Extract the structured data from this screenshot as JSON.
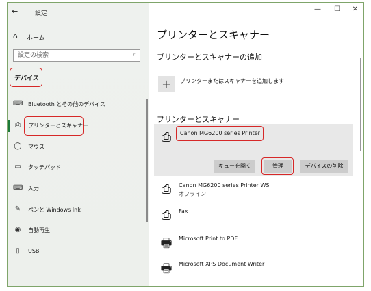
{
  "window": {
    "back_label": "←",
    "title": "設定",
    "minimize_label": "—",
    "maximize_label": "☐",
    "close_label": "✕"
  },
  "sidebar": {
    "home_label": "ホーム",
    "search_placeholder": "設定の検索",
    "category": "デバイス",
    "items": [
      {
        "label": "Bluetooth とその他のデバイス",
        "icon": "bluetooth-devices-icon",
        "glyph": "⌨"
      },
      {
        "label": "プリンターとスキャナー",
        "icon": "printer-icon",
        "glyph": "⎙",
        "active": true
      },
      {
        "label": "マウス",
        "icon": "mouse-icon",
        "glyph": "◯"
      },
      {
        "label": "タッチパッド",
        "icon": "touchpad-icon",
        "glyph": "▭"
      },
      {
        "label": "入力",
        "icon": "keyboard-icon",
        "glyph": "⌨"
      },
      {
        "label": "ペンと Windows Ink",
        "icon": "pen-icon",
        "glyph": "✎"
      },
      {
        "label": "自動再生",
        "icon": "autoplay-icon",
        "glyph": "◉"
      },
      {
        "label": "USB",
        "icon": "usb-icon",
        "glyph": "▯"
      }
    ]
  },
  "main": {
    "title": "プリンターとスキャナー",
    "add_section_title": "プリンターとスキャナーの追加",
    "add_button_symbol": "+",
    "add_button_label": "プリンターまたはスキャナーを追加します",
    "list_section_title": "プリンターとスキャナー",
    "selected_printer": {
      "name": "Canon MG6200 series Printer",
      "buttons": {
        "open_queue": "キューを開く",
        "manage": "管理",
        "remove": "デバイスの削除"
      }
    },
    "printers": [
      {
        "name": "Canon MG6200 series Printer WS",
        "status": "オフライン",
        "icon": "printer-icon"
      },
      {
        "name": "Fax",
        "status": "",
        "icon": "fax-icon"
      },
      {
        "name": "Microsoft Print to PDF",
        "status": "",
        "icon": "pdf-printer-icon"
      },
      {
        "name": "Microsoft XPS Document Writer",
        "status": "",
        "icon": "xps-printer-icon"
      }
    ]
  },
  "colors": {
    "highlight_outline": "#d62828",
    "active_indicator": "#1c7a3a",
    "frame_border": "#7fa56a"
  }
}
